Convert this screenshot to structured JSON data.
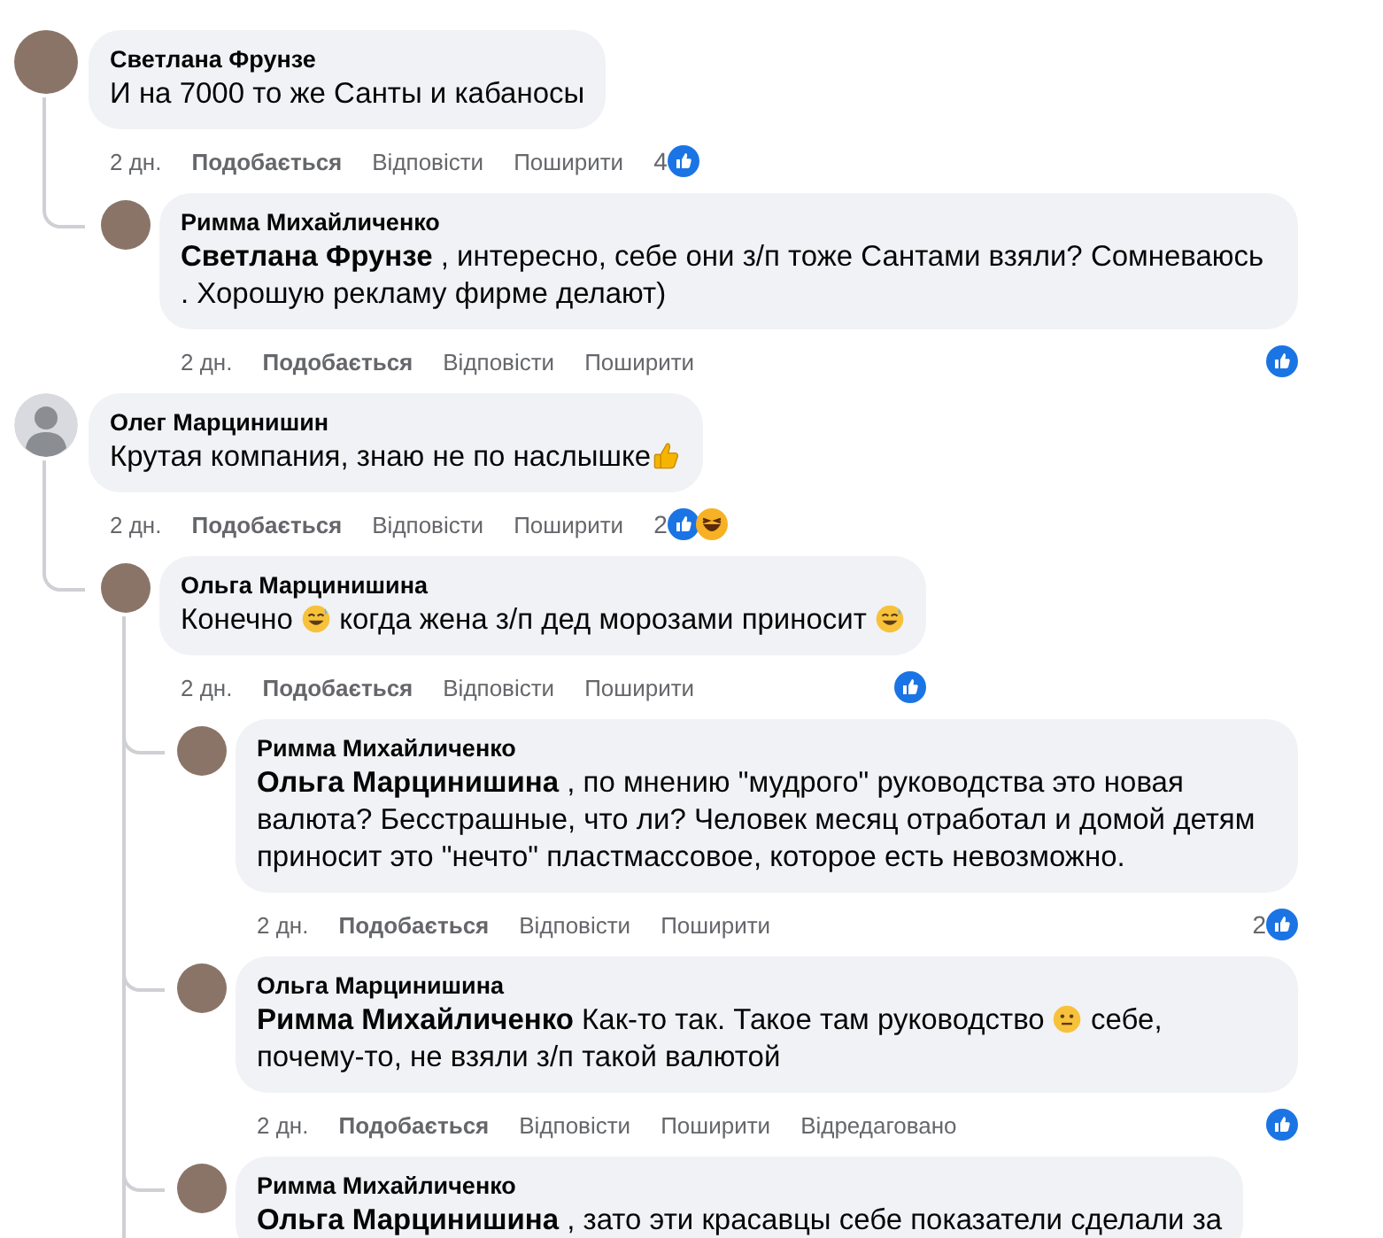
{
  "comments": [
    {
      "author": "Светлана Фрунзе",
      "avatar": {
        "kind": "photo"
      },
      "body": [
        {
          "kind": "text",
          "text": "И на 7000 то же Санты и кабаносы"
        }
      ],
      "time": "2 дн.",
      "actions": [
        "Подобається",
        "Відповісти",
        "Поширити"
      ],
      "reactions": {
        "count": "4",
        "icons": [
          {
            "kind": "like"
          }
        ]
      },
      "children": [
        {
          "author": "Римма Михайличенко",
          "avatar": {
            "kind": "photo"
          },
          "body": [
            {
              "kind": "text",
              "text": "**Светлана Фрунзе** , интересно, себе они з/п тоже Сантами взяли? Сомневаюсь . Хорошую рекламу фирме делают)"
            }
          ],
          "time": "2 дн.",
          "actions": [
            "Подобається",
            "Відповісти",
            "Поширити"
          ],
          "reactions": {
            "icons": [
              {
                "kind": "like"
              }
            ]
          }
        }
      ]
    },
    {
      "author": "Олег Марцинишин",
      "avatar": {
        "kind": "silhouette"
      },
      "body": [
        {
          "kind": "text",
          "text": "Крутая компания, знаю не по наслышке"
        },
        {
          "kind": "thumbsup"
        }
      ],
      "time": "2 дн.",
      "actions": [
        "Подобається",
        "Відповісти",
        "Поширити"
      ],
      "reactions": {
        "count": "2",
        "icons": [
          {
            "kind": "like"
          },
          {
            "kind": "haha"
          }
        ]
      },
      "children": [
        {
          "author": "Ольга Марцинишина",
          "avatar": {
            "kind": "photo"
          },
          "body": [
            {
              "kind": "text",
              "text": "Конечно "
            },
            {
              "kind": "sweatsmile"
            },
            {
              "kind": "text",
              "text": " когда жена з/п дед морозами приносит "
            },
            {
              "kind": "sweatsmile"
            }
          ],
          "time": "2 дн.",
          "actions": [
            "Подобається",
            "Відповісти",
            "Поширити"
          ],
          "reactions": {
            "icons": [
              {
                "kind": "like"
              }
            ]
          },
          "children": [
            {
              "author": "Римма Михайличенко",
              "avatar": {
                "kind": "photo"
              },
              "body": [
                {
                  "kind": "text",
                  "text": "**Ольга Марцинишина** , по мнению \"мудрого\" руководства это новая валюта? Бесстрашные, что ли? Человек месяц отработал и домой детям приносит это \"нечто\" пластмассовое, которое есть невозможно."
                }
              ],
              "time": "2 дн.",
              "actions": [
                "Подобається",
                "Відповісти",
                "Поширити"
              ],
              "reactions": {
                "count": "2",
                "icons": [
                  {
                    "kind": "like"
                  }
                ]
              }
            },
            {
              "author": "Ольга Марцинишина",
              "avatar": {
                "kind": "photo"
              },
              "body": [
                {
                  "kind": "text",
                  "text": "**Римма Михайличенко** Как-то так. Такое там руководство "
                },
                {
                  "kind": "neutral"
                },
                {
                  "kind": "text",
                  "text": " себе, почему-то, не взяли з/п такой валютой"
                }
              ],
              "time": "2 дн.",
              "actions": [
                "Подобається",
                "Відповісти",
                "Поширити"
              ],
              "edited": "Відредаговано",
              "reactions": {
                "icons": [
                  {
                    "kind": "like"
                  }
                ]
              }
            },
            {
              "author": "Римма Михайличенко",
              "avatar": {
                "kind": "photo"
              },
              "body": [
                {
                  "kind": "text",
                  "text": "**Ольга Марцинишина** , зато эти красавцы себе показатели сделали за"
                }
              ]
            }
          ]
        }
      ]
    }
  ]
}
